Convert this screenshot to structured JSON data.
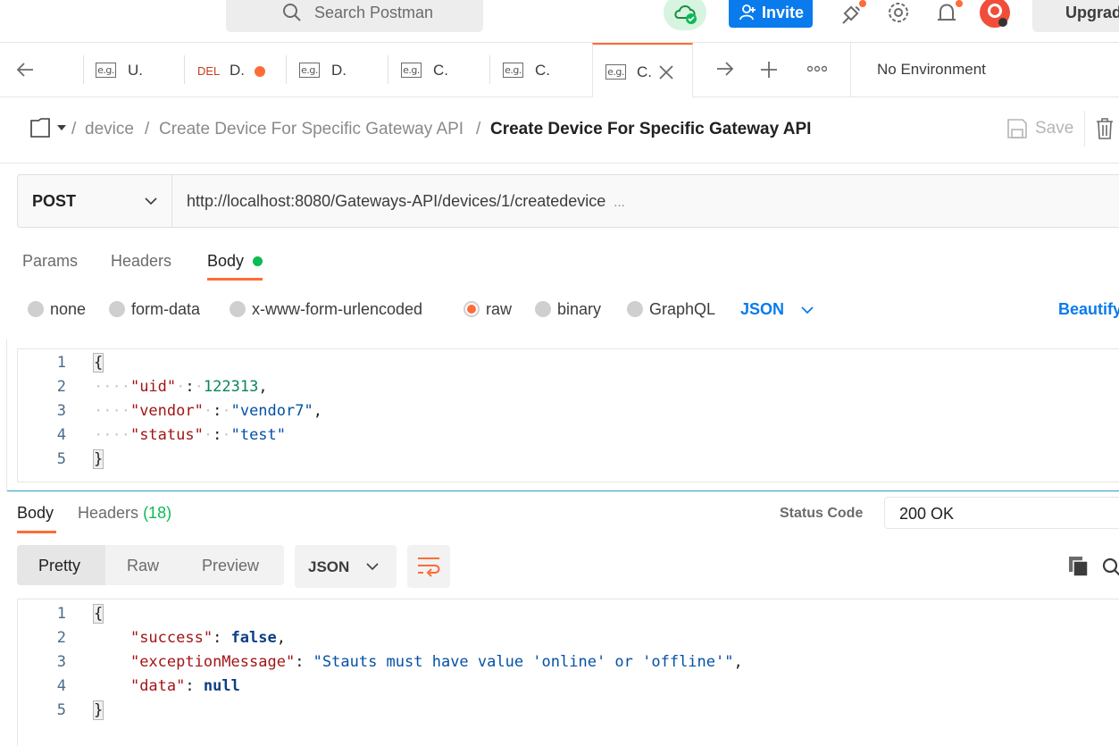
{
  "topbar": {
    "search_placeholder": "Search Postman",
    "invite_label": "Invite",
    "upgrade_label": "Upgrade"
  },
  "tabs": [
    {
      "tag": "e.g.",
      "title": "U."
    },
    {
      "tag": "DEL",
      "title": "D."
    },
    {
      "tag": "e.g.",
      "title": "D."
    },
    {
      "tag": "e.g.",
      "title": "C."
    },
    {
      "tag": "e.g.",
      "title": "C."
    },
    {
      "tag": "e.g.",
      "title": "C."
    }
  ],
  "environment": "No Environment",
  "breadcrumb": {
    "sep": "/",
    "folder": "device",
    "parent": "Create Device For Specific Gateway API",
    "current": "Create Device For Specific Gateway API",
    "save_label": "Save"
  },
  "request": {
    "method": "POST",
    "url": "http://localhost:8080/Gateways-API/devices/1/createdevice",
    "url_ellipsis": "...",
    "tabs": {
      "params": "Params",
      "headers": "Headers",
      "body": "Body"
    },
    "body_types": [
      "none",
      "form-data",
      "x-www-form-urlencoded",
      "raw",
      "binary",
      "GraphQL"
    ],
    "selected_body_type": "raw",
    "language": "JSON",
    "beautify": "Beautify",
    "body_lines": [
      {
        "n": "1"
      },
      {
        "n": "2",
        "key": "\"uid\"",
        "val": "122313"
      },
      {
        "n": "3",
        "key": "\"vendor\"",
        "val": "\"vendor7\""
      },
      {
        "n": "4",
        "key": "\"status\"",
        "val": "\"test\""
      },
      {
        "n": "5"
      }
    ]
  },
  "response": {
    "tab_body": "Body",
    "tab_headers": "Headers",
    "headers_count": "(18)",
    "status_label": "Status Code",
    "status_value": "200 OK",
    "view_pretty": "Pretty",
    "view_raw": "Raw",
    "view_preview": "Preview",
    "format": "JSON",
    "lines": [
      {
        "n": "1"
      },
      {
        "n": "2",
        "key": "\"success\"",
        "val": "false"
      },
      {
        "n": "3",
        "key": "\"exceptionMessage\"",
        "val": "\"Stauts must have value 'online' or 'offline'\""
      },
      {
        "n": "4",
        "key": "\"data\"",
        "val": "null"
      },
      {
        "n": "5"
      }
    ]
  },
  "colors": {
    "accent": "#ff6c37",
    "primary": "#097bed",
    "green": "#0cbb52"
  }
}
